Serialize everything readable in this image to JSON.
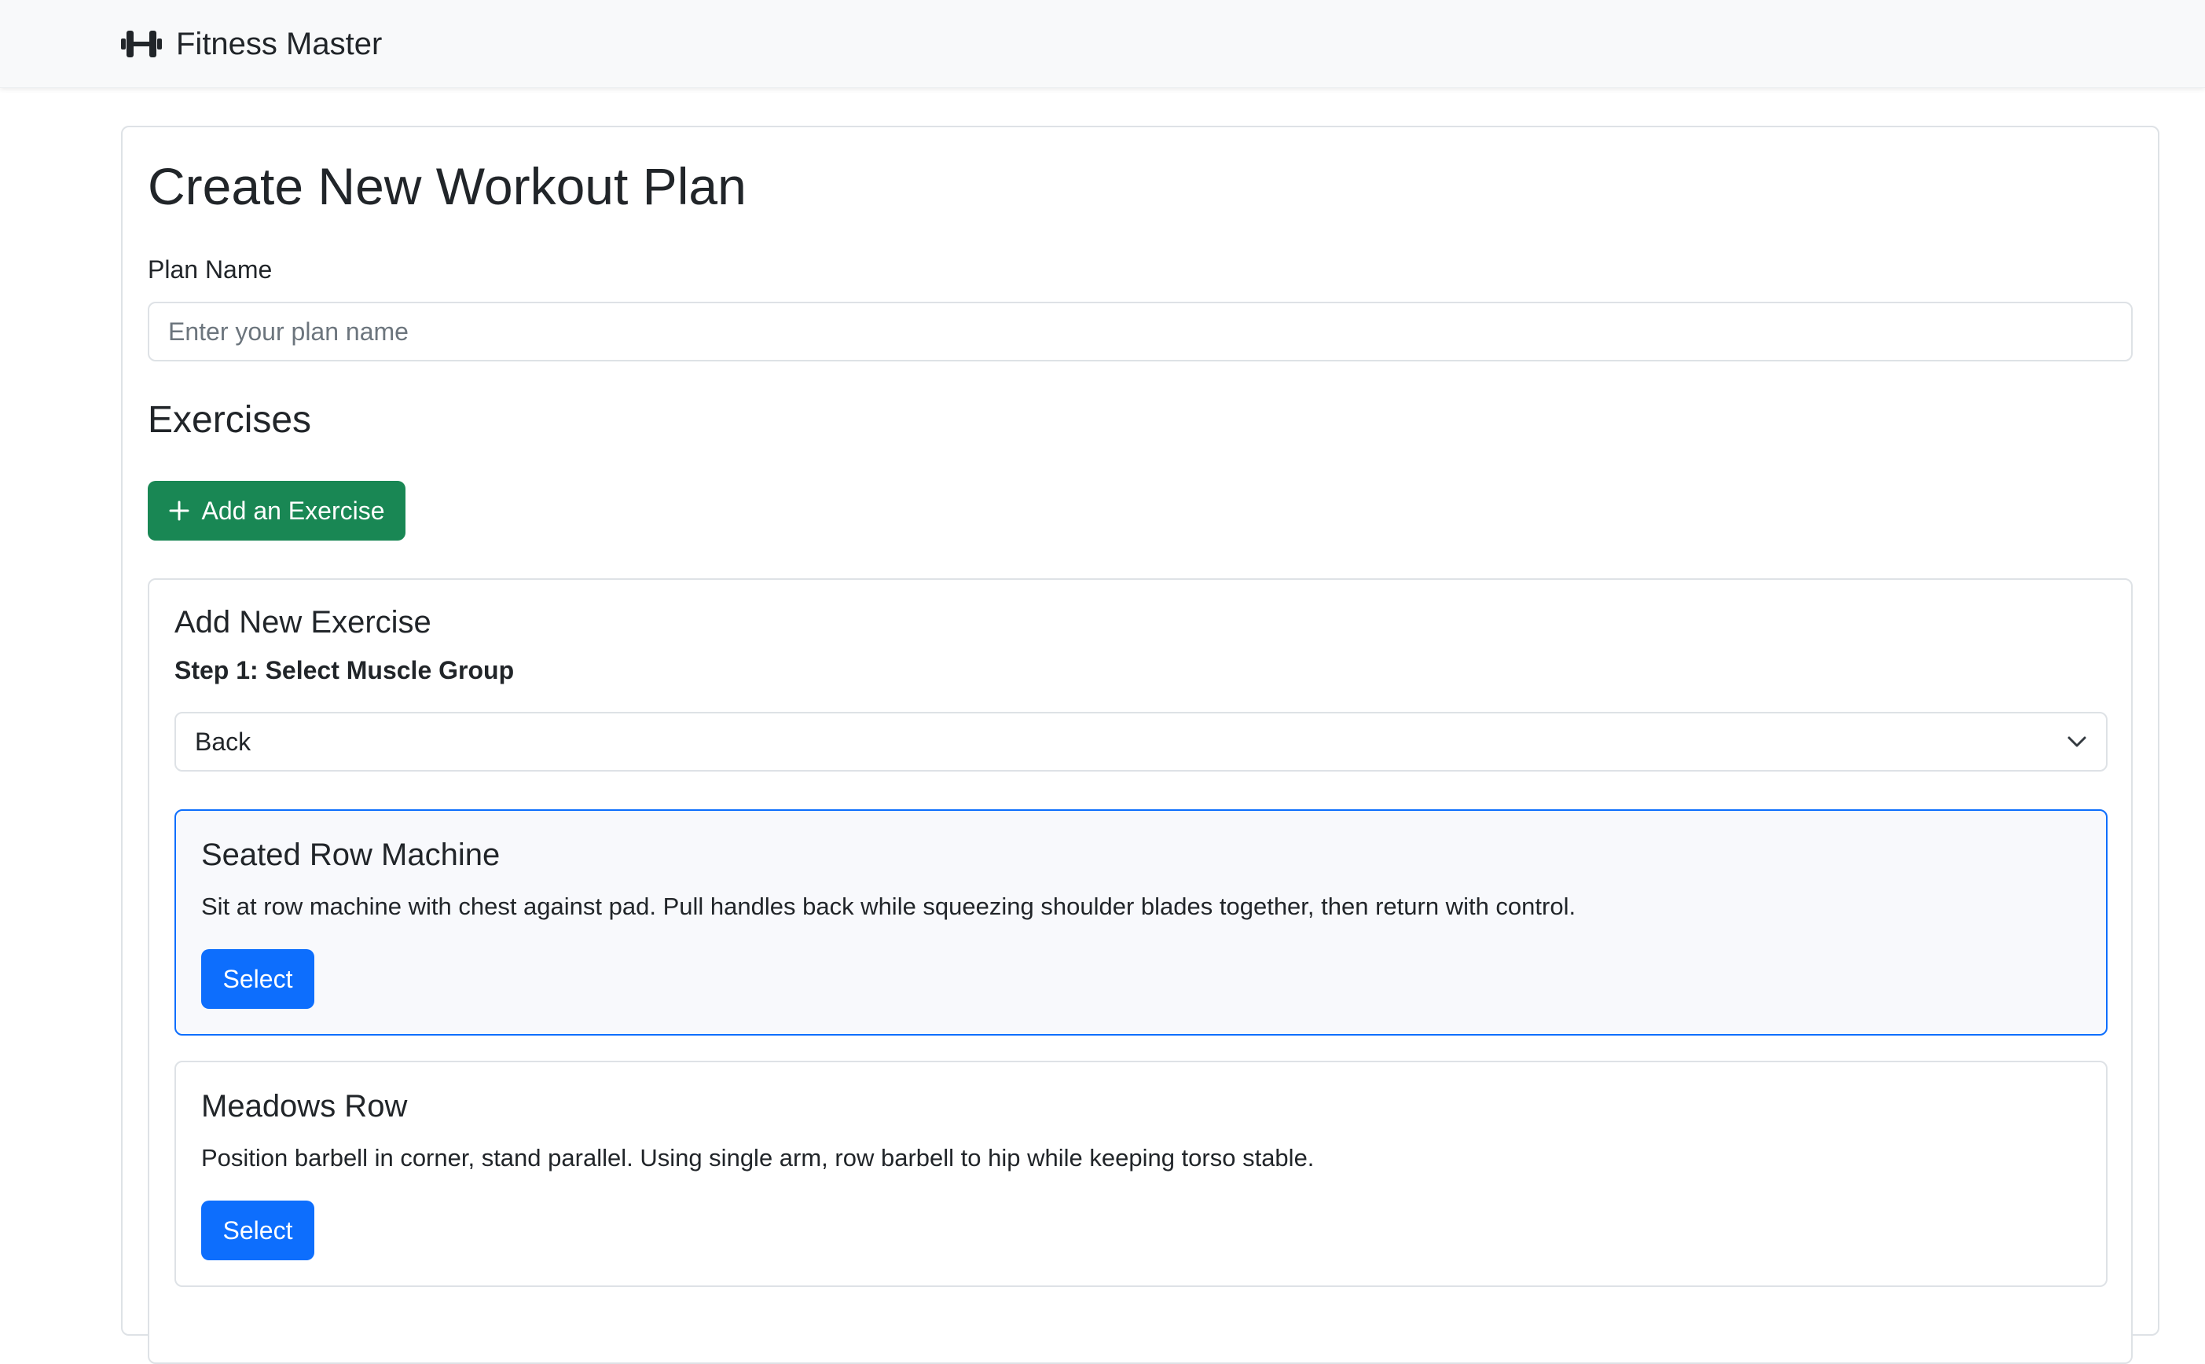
{
  "navbar": {
    "brand_icon": "dumbbell-icon",
    "brand_text": "Fitness Master"
  },
  "page": {
    "title": "Create New Workout Plan",
    "plan_name_label": "Plan Name",
    "plan_name_placeholder": "Enter your plan name",
    "plan_name_value": "",
    "exercises_heading": "Exercises",
    "add_exercise_label": "Add an Exercise",
    "add_exercise_icon": "plus-icon"
  },
  "add_exercise_panel": {
    "title": "Add New Exercise",
    "step_label": "Step 1: Select Muscle Group",
    "muscle_group_selected": "Back",
    "exercises": [
      {
        "name": "Seated Row Machine",
        "description": "Sit at row machine with chest against pad. Pull handles back while squeezing shoulder blades together, then return with control.",
        "select_label": "Select",
        "highlighted": true
      },
      {
        "name": "Meadows Row",
        "description": "Position barbell in corner, stand parallel. Using single arm, row barbell to hip while keeping torso stable.",
        "select_label": "Select",
        "highlighted": false
      }
    ]
  },
  "colors": {
    "success": "#198754",
    "primary": "#0d6efd",
    "navbar_bg": "#f8f9fa",
    "border": "#dee2e6"
  }
}
